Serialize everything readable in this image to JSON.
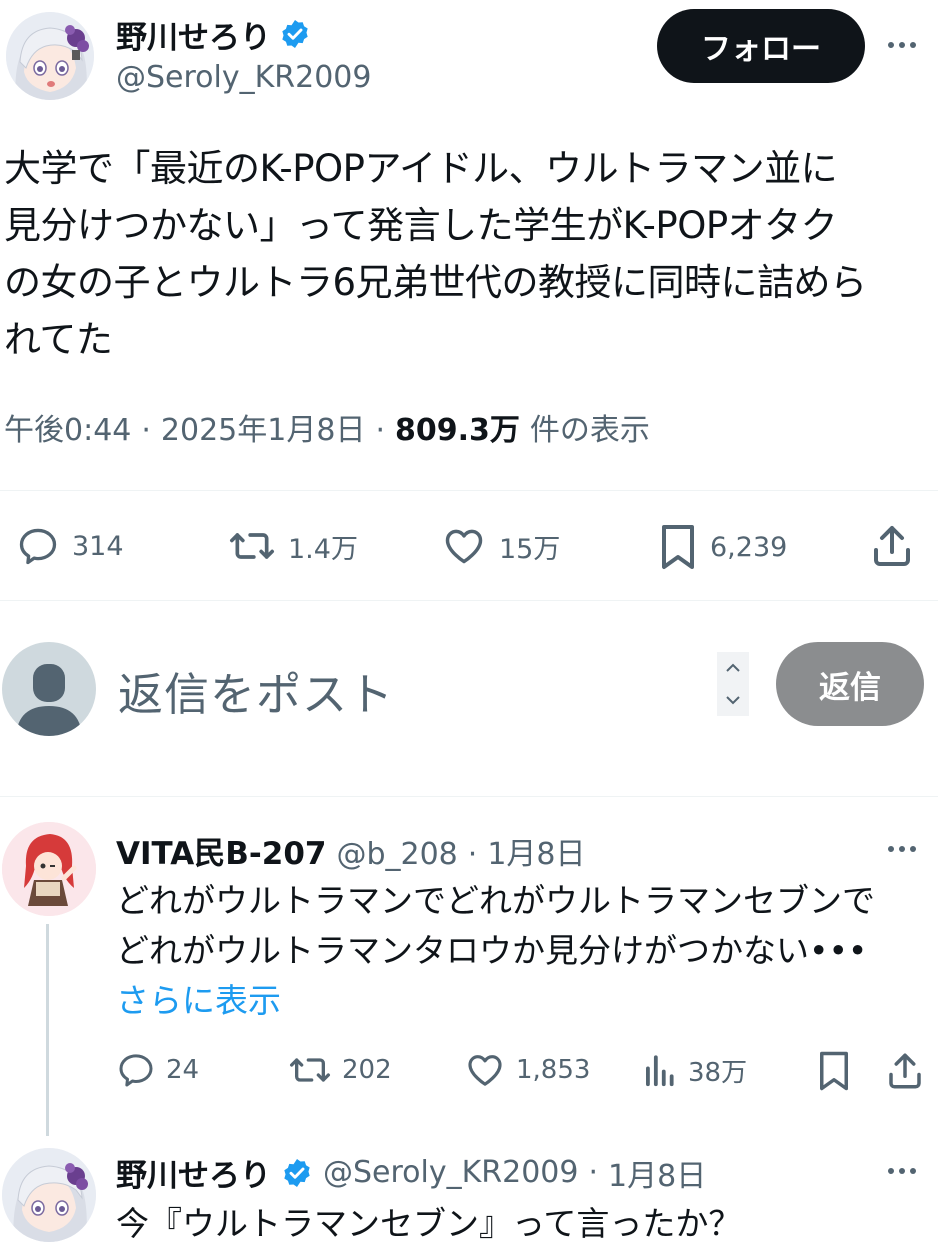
{
  "main_post": {
    "display_name": "野川せろり",
    "handle": "@Seroly_KR2009",
    "follow_label": "フォロー",
    "text_lines": [
      "大学で「最近のK-POPアイドル、ウルトラマン並に",
      "見分けつかない」って発言した学生がK-POPオタク",
      "の女の子とウルトラ6兄弟世代の教授に同時に詰めら",
      "れてた"
    ],
    "time": "午後0:44",
    "sep1": "·",
    "date": "2025年1月8日",
    "sep2": "·",
    "views": "809.3万",
    "views_label": "件の表示",
    "stats": {
      "replies": "314",
      "reposts": "1.4万",
      "likes": "15万",
      "bookmarks": "6,239"
    }
  },
  "composer": {
    "placeholder": "返信をポスト",
    "reply_label": "返信"
  },
  "replies": [
    {
      "display_name": "VITA民B-207",
      "handle": "@b_208",
      "sep": "·",
      "date": "1月8日",
      "text_lines": [
        "どれがウルトラマンでどれがウルトラマンセブンで",
        "どれがウルトラマンタロウか見分けがつかない•••"
      ],
      "show_more": "さらに表示",
      "stats": {
        "replies": "24",
        "reposts": "202",
        "likes": "1,853",
        "views": "38万"
      }
    },
    {
      "display_name": "野川せろり",
      "handle": "@Seroly_KR2009",
      "sep": "·",
      "date": "1月8日",
      "text_lines": [
        "今『ウルトラマンセブン』って言ったか？"
      ]
    }
  ],
  "colors": {
    "verified": "#1d9bf0",
    "link": "#1d9bf0",
    "follow_bg": "#0f1419",
    "reply_button_bg": "#8b8d8f",
    "muted": "#536471"
  }
}
